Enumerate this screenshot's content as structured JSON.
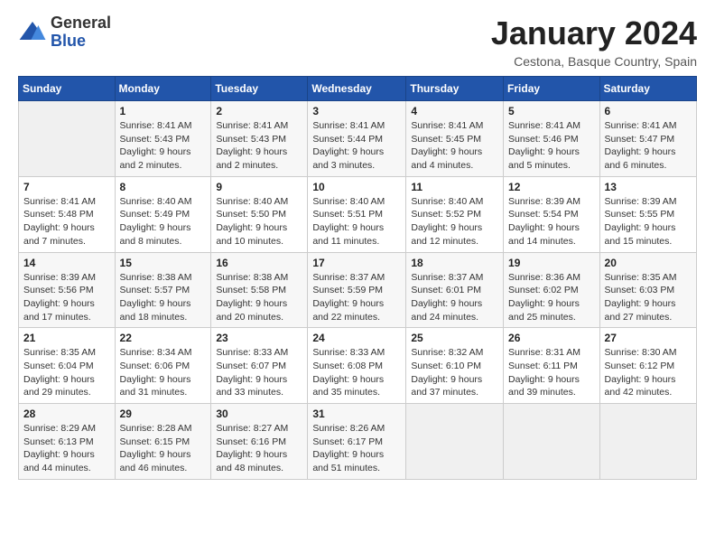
{
  "logo": {
    "general": "General",
    "blue": "Blue"
  },
  "title": "January 2024",
  "location": "Cestona, Basque Country, Spain",
  "days_of_week": [
    "Sunday",
    "Monday",
    "Tuesday",
    "Wednesday",
    "Thursday",
    "Friday",
    "Saturday"
  ],
  "weeks": [
    [
      {
        "day": "",
        "info": ""
      },
      {
        "day": "1",
        "info": "Sunrise: 8:41 AM\nSunset: 5:43 PM\nDaylight: 9 hours\nand 2 minutes."
      },
      {
        "day": "2",
        "info": "Sunrise: 8:41 AM\nSunset: 5:43 PM\nDaylight: 9 hours\nand 2 minutes."
      },
      {
        "day": "3",
        "info": "Sunrise: 8:41 AM\nSunset: 5:44 PM\nDaylight: 9 hours\nand 3 minutes."
      },
      {
        "day": "4",
        "info": "Sunrise: 8:41 AM\nSunset: 5:45 PM\nDaylight: 9 hours\nand 4 minutes."
      },
      {
        "day": "5",
        "info": "Sunrise: 8:41 AM\nSunset: 5:46 PM\nDaylight: 9 hours\nand 5 minutes."
      },
      {
        "day": "6",
        "info": "Sunrise: 8:41 AM\nSunset: 5:47 PM\nDaylight: 9 hours\nand 6 minutes."
      }
    ],
    [
      {
        "day": "7",
        "info": "Sunrise: 8:41 AM\nSunset: 5:48 PM\nDaylight: 9 hours\nand 7 minutes."
      },
      {
        "day": "8",
        "info": "Sunrise: 8:40 AM\nSunset: 5:49 PM\nDaylight: 9 hours\nand 8 minutes."
      },
      {
        "day": "9",
        "info": "Sunrise: 8:40 AM\nSunset: 5:50 PM\nDaylight: 9 hours\nand 10 minutes."
      },
      {
        "day": "10",
        "info": "Sunrise: 8:40 AM\nSunset: 5:51 PM\nDaylight: 9 hours\nand 11 minutes."
      },
      {
        "day": "11",
        "info": "Sunrise: 8:40 AM\nSunset: 5:52 PM\nDaylight: 9 hours\nand 12 minutes."
      },
      {
        "day": "12",
        "info": "Sunrise: 8:39 AM\nSunset: 5:54 PM\nDaylight: 9 hours\nand 14 minutes."
      },
      {
        "day": "13",
        "info": "Sunrise: 8:39 AM\nSunset: 5:55 PM\nDaylight: 9 hours\nand 15 minutes."
      }
    ],
    [
      {
        "day": "14",
        "info": "Sunrise: 8:39 AM\nSunset: 5:56 PM\nDaylight: 9 hours\nand 17 minutes."
      },
      {
        "day": "15",
        "info": "Sunrise: 8:38 AM\nSunset: 5:57 PM\nDaylight: 9 hours\nand 18 minutes."
      },
      {
        "day": "16",
        "info": "Sunrise: 8:38 AM\nSunset: 5:58 PM\nDaylight: 9 hours\nand 20 minutes."
      },
      {
        "day": "17",
        "info": "Sunrise: 8:37 AM\nSunset: 5:59 PM\nDaylight: 9 hours\nand 22 minutes."
      },
      {
        "day": "18",
        "info": "Sunrise: 8:37 AM\nSunset: 6:01 PM\nDaylight: 9 hours\nand 24 minutes."
      },
      {
        "day": "19",
        "info": "Sunrise: 8:36 AM\nSunset: 6:02 PM\nDaylight: 9 hours\nand 25 minutes."
      },
      {
        "day": "20",
        "info": "Sunrise: 8:35 AM\nSunset: 6:03 PM\nDaylight: 9 hours\nand 27 minutes."
      }
    ],
    [
      {
        "day": "21",
        "info": "Sunrise: 8:35 AM\nSunset: 6:04 PM\nDaylight: 9 hours\nand 29 minutes."
      },
      {
        "day": "22",
        "info": "Sunrise: 8:34 AM\nSunset: 6:06 PM\nDaylight: 9 hours\nand 31 minutes."
      },
      {
        "day": "23",
        "info": "Sunrise: 8:33 AM\nSunset: 6:07 PM\nDaylight: 9 hours\nand 33 minutes."
      },
      {
        "day": "24",
        "info": "Sunrise: 8:33 AM\nSunset: 6:08 PM\nDaylight: 9 hours\nand 35 minutes."
      },
      {
        "day": "25",
        "info": "Sunrise: 8:32 AM\nSunset: 6:10 PM\nDaylight: 9 hours\nand 37 minutes."
      },
      {
        "day": "26",
        "info": "Sunrise: 8:31 AM\nSunset: 6:11 PM\nDaylight: 9 hours\nand 39 minutes."
      },
      {
        "day": "27",
        "info": "Sunrise: 8:30 AM\nSunset: 6:12 PM\nDaylight: 9 hours\nand 42 minutes."
      }
    ],
    [
      {
        "day": "28",
        "info": "Sunrise: 8:29 AM\nSunset: 6:13 PM\nDaylight: 9 hours\nand 44 minutes."
      },
      {
        "day": "29",
        "info": "Sunrise: 8:28 AM\nSunset: 6:15 PM\nDaylight: 9 hours\nand 46 minutes."
      },
      {
        "day": "30",
        "info": "Sunrise: 8:27 AM\nSunset: 6:16 PM\nDaylight: 9 hours\nand 48 minutes."
      },
      {
        "day": "31",
        "info": "Sunrise: 8:26 AM\nSunset: 6:17 PM\nDaylight: 9 hours\nand 51 minutes."
      },
      {
        "day": "",
        "info": ""
      },
      {
        "day": "",
        "info": ""
      },
      {
        "day": "",
        "info": ""
      }
    ]
  ]
}
